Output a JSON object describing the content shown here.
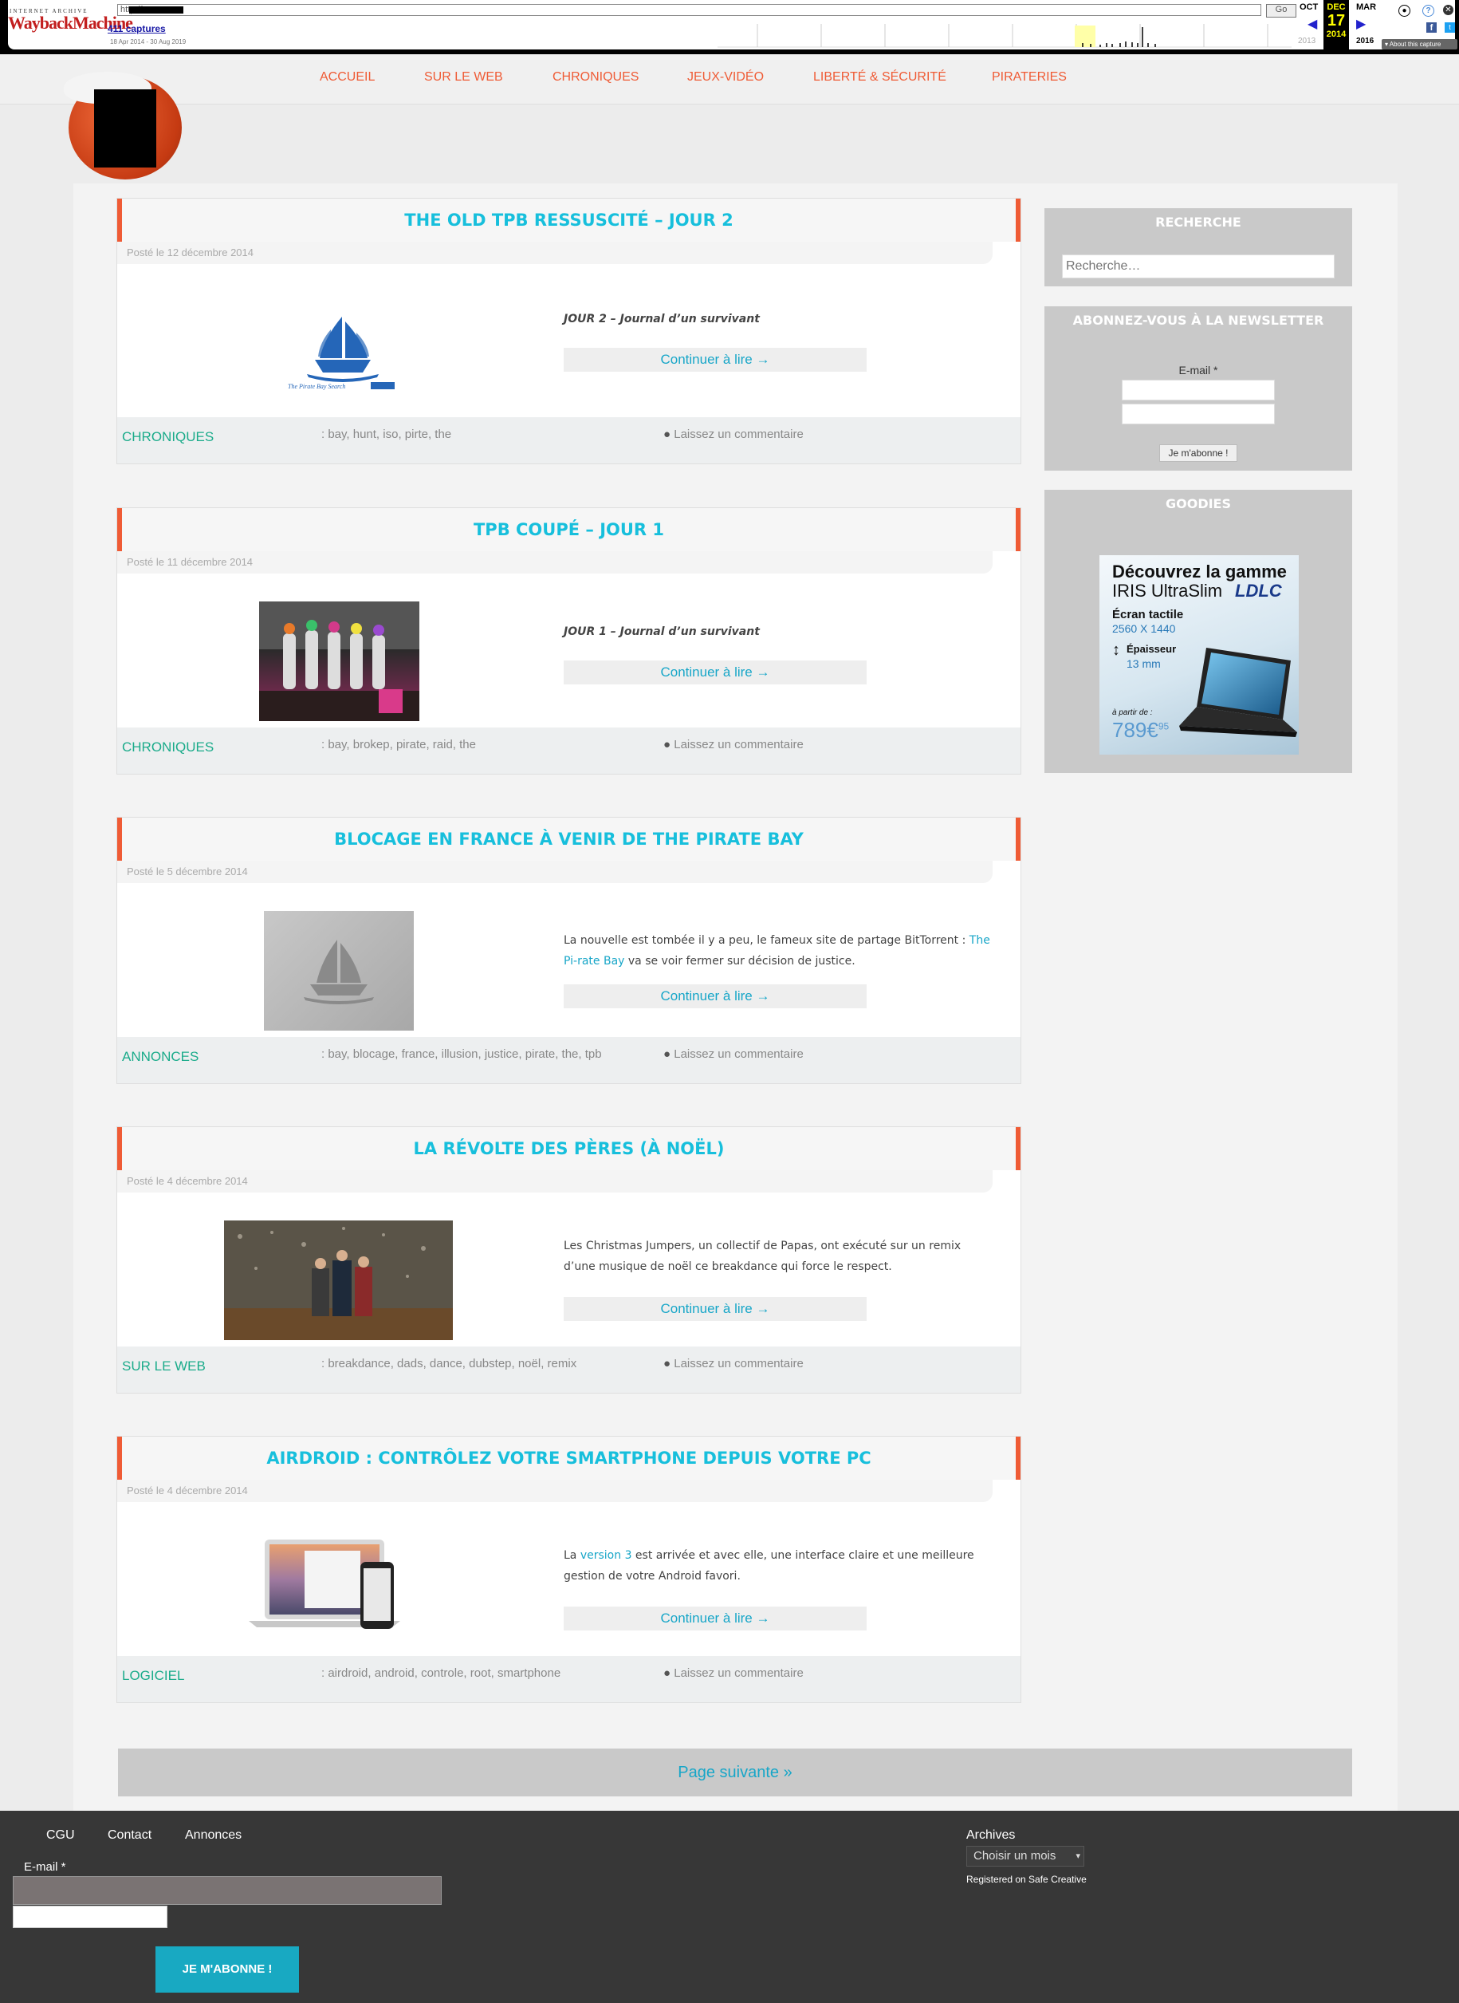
{
  "wayback": {
    "logo_top": "INTERNET ARCHIVE",
    "logo": "WaybackMachine",
    "url_value": "http://",
    "go_label": "Go",
    "captures": "411 captures",
    "date_range": "18 Apr 2014 - 30 Aug 2019",
    "month_prev": "OCT",
    "month_cur": "DEC",
    "day_cur": "17",
    "year_cur": "2014",
    "month_next": "MAR",
    "year_prev": "2013",
    "year_next": "2016",
    "about": "About this capture",
    "icons": [
      "user-icon",
      "help-icon",
      "close-icon",
      "facebook-icon",
      "twitter-icon"
    ]
  },
  "nav": {
    "items": [
      "ACCUEIL",
      "SUR LE WEB",
      "CHRONIQUES",
      "JEUX-VIDÉO",
      "LIBERTÉ & SÉCURITÉ",
      "PIRATERIES"
    ]
  },
  "posts": [
    {
      "title": "THE OLD TPB RESSUSCITÉ – JOUR 2",
      "date": "Posté le 12 décembre 2014",
      "excerpt": "JOUR 2 – Journal d’un survivant",
      "button": "Continuer à lire →",
      "category": "CHRONIQUES",
      "tags": ": bay, hunt, iso, pirte, the",
      "comment": "Laissez un commentaire",
      "image": "pirate-bay-logo",
      "image_caption": "The Pirate Bay Search"
    },
    {
      "title": "TPB COUPÉ – JOUR 1",
      "date": "Posté le 11 décembre 2014",
      "excerpt": "JOUR 1 – Journal d’un survivant",
      "button": "Continuer à lire →",
      "category": "CHRONIQUES",
      "tags": ": bay, brokep, pirate, raid, the",
      "comment": "Laissez un commentaire",
      "image": "cosplay-photo"
    },
    {
      "title": "BLOCAGE EN FRANCE À VENIR DE THE PIRATE BAY",
      "date": "Posté le 5 décembre 2014",
      "excerpt_pre": "La nouvelle est tombée il y a peu, le fameux site de partage BitTorrent : ",
      "excerpt_link": "The Pi-rate Bay",
      "excerpt_post": " va se voir fermer sur décision de justice.",
      "button": "Continuer à lire →",
      "category": "ANNONCES",
      "tags": ": bay, blocage, france, illusion, justice, pirate, the, tpb",
      "comment": "Laissez un commentaire",
      "image": "pirate-ship-grey"
    },
    {
      "title": "LA RÉVOLTE DES PÈRES (À NOËL)",
      "date": "Posté le 4 décembre 2014",
      "excerpt": "Les Christmas Jumpers, un collectif de Papas, ont exécuté sur un remix d’une musique de noël ce breakdance qui force le respect.",
      "button": "Continuer à lire →",
      "category": "SUR LE WEB",
      "tags": ": breakdance, dads, dance, dubstep, noël, remix",
      "comment": "Laissez un commentaire",
      "image": "stage-photo"
    },
    {
      "title": "AIRDROID : CONTRÔLEZ VOTRE SMARTPHONE DEPUIS VOTRE PC",
      "date": "Posté le 4 décembre 2014",
      "excerpt_pre": "La ",
      "excerpt_link": "version 3",
      "excerpt_post": " est arrivée et avec elle, une interface claire et une meilleure gestion de votre Android favori.",
      "button": "Continuer à lire →",
      "category": "LOGICIEL",
      "tags": ": airdroid, android, controle, root, smartphone",
      "comment": "Laissez un commentaire",
      "image": "laptop-phone"
    }
  ],
  "sidebar": {
    "search_title": "RECHERCHE",
    "search_placeholder": "Recherche…",
    "newsletter_title": "ABONNEZ-VOUS À LA NEWSLETTER",
    "email_label": "E-mail *",
    "subscribe_label": "Je m'abonne !",
    "goodies_title": "GOODIES",
    "ad": {
      "line1": "Découvrez la gamme",
      "line2": "IRIS UltraSlim",
      "brand": "LDLC",
      "screen": "Écran tactile",
      "resolution": "2560 X 1440",
      "thickness_label": "Épaisseur",
      "thickness": "13 mm",
      "price_prefix": "à partir de :",
      "price": "789€",
      "price_cents": "95"
    }
  },
  "pager": {
    "next": "Page suivante »"
  },
  "footer": {
    "links": [
      "CGU",
      "Contact",
      "Annonces"
    ],
    "email_label": "E-mail *",
    "subscribe": "JE M'ABONNE !",
    "archives_title": "Archives",
    "archives_select": "Choisir un mois",
    "safe_creative": "Registered on Safe Creative"
  }
}
